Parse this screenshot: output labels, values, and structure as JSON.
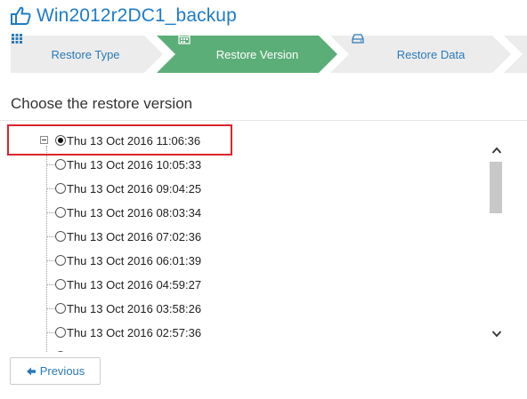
{
  "page": {
    "title": "Win2012r2DC1_backup",
    "title_icon": "thumbs-up-icon"
  },
  "wizard": {
    "steps": [
      {
        "label": "Restore Type",
        "icon": "grid-icon",
        "state": "inactive"
      },
      {
        "label": "Restore Version",
        "icon": "calendar-icon",
        "state": "active"
      },
      {
        "label": "Restore Data",
        "icon": "hard-drive-icon",
        "state": "inactive"
      }
    ],
    "colors": {
      "active": "#5cae78",
      "inactive": "#ececec",
      "label": "#2a7ab8"
    }
  },
  "section": {
    "heading": "Choose the restore version"
  },
  "tree": {
    "versions": [
      {
        "label": "Thu 13 Oct 2016 11:06:36",
        "selected": true,
        "expanded": true
      },
      {
        "label": "Thu 13 Oct 2016 10:05:33",
        "selected": false
      },
      {
        "label": "Thu 13 Oct 2016 09:04:25",
        "selected": false
      },
      {
        "label": "Thu 13 Oct 2016 08:03:34",
        "selected": false
      },
      {
        "label": "Thu 13 Oct 2016 07:02:36",
        "selected": false
      },
      {
        "label": "Thu 13 Oct 2016 06:01:39",
        "selected": false
      },
      {
        "label": "Thu 13 Oct 2016 04:59:27",
        "selected": false
      },
      {
        "label": "Thu 13 Oct 2016 03:58:26",
        "selected": false
      },
      {
        "label": "Thu 13 Oct 2016 02:57:36",
        "selected": false
      }
    ],
    "highlight_color": "#d9262a"
  },
  "footer": {
    "previous_label": "Previous",
    "previous_icon": "arrow-left-icon"
  }
}
